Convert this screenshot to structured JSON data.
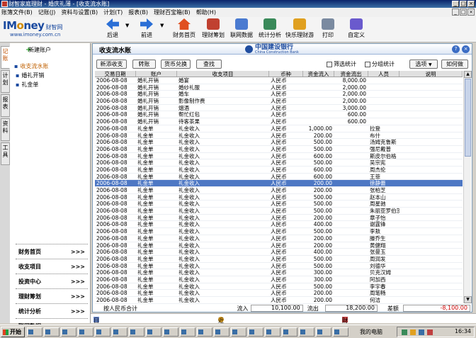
{
  "window": {
    "title": "财智家庭理财 - 婚庆礼薄 - [收支流水账]"
  },
  "menu": [
    "账簿文件(B)",
    "记账(J)",
    "资料与设置(B)",
    "计划(T)",
    "报表(B)",
    "理财百宝箱(B)",
    "帮助(H)"
  ],
  "logo": {
    "brand_a": "IM",
    "brand_o": "o",
    "brand_b": "ney",
    "sub": "财智网",
    "url": "www.imoney.com.cn"
  },
  "toolbar": {
    "back": "后退",
    "forward": "前进",
    "home": "财务首页",
    "plan": "理财筹划",
    "online": "联网数据",
    "stats": "统计分析",
    "happy": "快乐理财游",
    "print": "打印",
    "custom": "自定义"
  },
  "colors": {
    "accent": "#1a4aa0",
    "selection": "#4e78c4",
    "highlight": "#c06000",
    "negative": "#d00000"
  },
  "vtabs": [
    "记账",
    "计划",
    "报表",
    "资料",
    "工具"
  ],
  "nav": {
    "new_account": "新建账户",
    "tree": [
      "收支流水账",
      "婚礼开销",
      "礼金单"
    ],
    "bottom": [
      "财务首页",
      "收支项目",
      "投资中心",
      "理财筹划",
      "统计分析",
      "联网数据"
    ],
    "arrow": ">>>"
  },
  "panel": {
    "title": "收支流水账",
    "bank_cn": "中国建设银行",
    "bank_en": "China Construction Bank",
    "help_icon": "?",
    "close_icon": "×"
  },
  "filters": {
    "add": "新添收支",
    "transfer": "转账",
    "currency": "货币兑换",
    "search": "查找",
    "filter_stats": "筛选统计",
    "group_stats": "分组统计",
    "options": "选项",
    "how": "如何做"
  },
  "table": {
    "headers": [
      "交易日期",
      "账户",
      "收支项目",
      "币种",
      "资金流入",
      "资金流出",
      "人员",
      "说明"
    ],
    "rows": [
      [
        "2006-08-08",
        "婚礼开销",
        "婚宴",
        "人民币",
        "",
        "8,000.00",
        "",
        ""
      ],
      [
        "2006-08-08",
        "婚礼开销",
        "婚纱礼服",
        "人民币",
        "",
        "2,000.00",
        "",
        ""
      ],
      [
        "2006-08-08",
        "婚礼开销",
        "婚车",
        "人民币",
        "",
        "2,000.00",
        "",
        ""
      ],
      [
        "2006-08-08",
        "婚礼开销",
        "影像制作费",
        "人民币",
        "",
        "2,000.00",
        "",
        ""
      ],
      [
        "2006-08-08",
        "婚礼开销",
        "烟酒",
        "人民币",
        "",
        "3,000.00",
        "",
        ""
      ],
      [
        "2006-08-08",
        "婚礼开销",
        "帮忙红包",
        "人民币",
        "",
        "600.00",
        "",
        ""
      ],
      [
        "2006-08-08",
        "婚礼开销",
        "待客茶果",
        "人民币",
        "",
        "600.00",
        "",
        ""
      ],
      [
        "2006-08-08",
        "礼金单",
        "礼金收入",
        "人民币",
        "1,000.00",
        "",
        "拉登",
        ""
      ],
      [
        "2006-08-08",
        "礼金单",
        "礼金收入",
        "人民币",
        "200.00",
        "",
        "布什",
        ""
      ],
      [
        "2006-08-08",
        "礼金单",
        "礼金收入",
        "人民币",
        "500.00",
        "",
        "汤姆克鲁斯",
        ""
      ],
      [
        "2006-08-08",
        "礼金单",
        "礼金收入",
        "人民币",
        "500.00",
        "",
        "强尼戴普",
        ""
      ],
      [
        "2006-08-08",
        "礼金单",
        "礼金收入",
        "人民币",
        "600.00",
        "",
        "斯皮尔伯格",
        ""
      ],
      [
        "2006-08-08",
        "礼金单",
        "礼金收入",
        "人民币",
        "500.00",
        "",
        "吴宗宪",
        ""
      ],
      [
        "2006-08-08",
        "礼金单",
        "礼金收入",
        "人民币",
        "600.00",
        "",
        "周杰伦",
        ""
      ],
      [
        "2006-08-08",
        "礼金单",
        "礼金收入",
        "人民币",
        "600.00",
        "",
        "王菲",
        ""
      ],
      [
        "2006-08-08",
        "礼金单",
        "礼金收入",
        "人民币",
        "200.00",
        "",
        "徐静蕾",
        ""
      ],
      [
        "2006-08-08",
        "礼金单",
        "礼金收入",
        "人民币",
        "200.00",
        "",
        "张柏芝",
        ""
      ],
      [
        "2006-08-08",
        "礼金单",
        "礼金收入",
        "人民币",
        "500.00",
        "",
        "赵本山",
        ""
      ],
      [
        "2006-08-08",
        "礼金单",
        "礼金收入",
        "人民币",
        "500.00",
        "",
        "周星驰",
        ""
      ],
      [
        "2006-08-08",
        "礼金单",
        "礼金收入",
        "人民币",
        "500.00",
        "",
        "朱丽亚罗伯茨",
        ""
      ],
      [
        "2006-08-08",
        "礼金单",
        "礼金收入",
        "人民币",
        "200.00",
        "",
        "章子怡",
        ""
      ],
      [
        "2006-08-08",
        "礼金单",
        "礼金收入",
        "人民币",
        "400.00",
        "",
        "谢霆锋",
        ""
      ],
      [
        "2006-08-08",
        "礼金单",
        "礼金收入",
        "人民币",
        "500.00",
        "",
        "李敖",
        ""
      ],
      [
        "2006-08-08",
        "礼金单",
        "礼金收入",
        "人民币",
        "200.00",
        "",
        "滕乔生",
        ""
      ],
      [
        "2006-08-08",
        "礼金单",
        "礼金收入",
        "人民币",
        "200.00",
        "",
        "黄健翔",
        ""
      ],
      [
        "2006-08-08",
        "礼金单",
        "礼金收入",
        "人民币",
        "400.00",
        "",
        "张曼玉",
        ""
      ],
      [
        "2006-08-08",
        "礼金单",
        "礼金收入",
        "人民币",
        "500.00",
        "",
        "周润发",
        ""
      ],
      [
        "2006-08-08",
        "礼金单",
        "礼金收入",
        "人民币",
        "500.00",
        "",
        "刘德华",
        ""
      ],
      [
        "2006-08-08",
        "礼金单",
        "礼金收入",
        "人民币",
        "300.00",
        "",
        "贝克汉姆",
        ""
      ],
      [
        "2006-08-08",
        "礼金单",
        "礼金收入",
        "人民币",
        "300.00",
        "",
        "阿加西",
        ""
      ],
      [
        "2006-08-08",
        "礼金单",
        "礼金收入",
        "人民币",
        "500.00",
        "",
        "李宇春",
        ""
      ],
      [
        "2006-08-08",
        "礼金单",
        "礼金收入",
        "人民币",
        "200.00",
        "",
        "周笔畅",
        ""
      ],
      [
        "2006-08-08",
        "礼金单",
        "礼金收入",
        "人民币",
        "200.00",
        "",
        "何洁",
        ""
      ]
    ],
    "selected_row": 15
  },
  "footer": {
    "label": "按人民币合计",
    "in_label": "流入",
    "in_value": "10,100.00",
    "out_label": "流出",
    "out_value": "18,200.00",
    "diff_label": "差额",
    "diff_value": "-8,100.00"
  },
  "links": [
    "日记",
    "近期提醒",
    "财务日历"
  ],
  "taskbar": {
    "start": "开始",
    "mypc": "我的电脑",
    "time": "16:34"
  }
}
